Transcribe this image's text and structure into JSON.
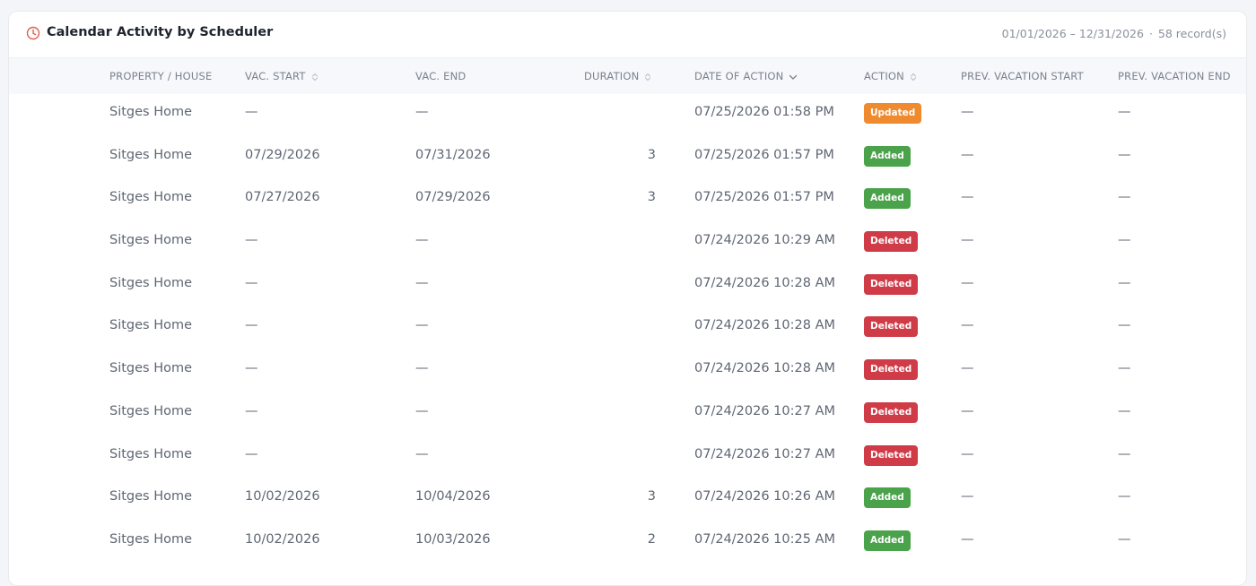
{
  "card": {
    "title": "Calendar Activity by Scheduler",
    "date_range": "01/01/2026 – 12/31/2026",
    "separator": "·",
    "record_count": "58 record(s)"
  },
  "columns": [
    {
      "label": "PROPERTY / HOUSE",
      "sortable": false,
      "sort": "none"
    },
    {
      "label": "VAC. START",
      "sortable": true,
      "sort": "none"
    },
    {
      "label": "VAC. END",
      "sortable": false,
      "sort": "none"
    },
    {
      "label": "DURATION",
      "sortable": true,
      "sort": "none"
    },
    {
      "label": "DATE OF ACTION",
      "sortable": true,
      "sort": "desc"
    },
    {
      "label": "ACTION",
      "sortable": true,
      "sort": "none"
    },
    {
      "label": "PREV. VACATION START",
      "sortable": false,
      "sort": "none"
    },
    {
      "label": "PREV. VACATION END",
      "sortable": false,
      "sort": "none"
    }
  ],
  "action_colors": {
    "Updated": "#ef8a2f",
    "Added": "#4aa24a",
    "Deleted": "#cf3b47"
  },
  "rows": [
    {
      "property": "Sitges Home",
      "vac_start": "—",
      "vac_end": "—",
      "duration": "",
      "date_of_action": "07/25/2026 01:58 PM",
      "action": "Updated",
      "prev_start": "—",
      "prev_end": "—"
    },
    {
      "property": "Sitges Home",
      "vac_start": "07/29/2026",
      "vac_end": "07/31/2026",
      "duration": "3",
      "date_of_action": "07/25/2026 01:57 PM",
      "action": "Added",
      "prev_start": "—",
      "prev_end": "—"
    },
    {
      "property": "Sitges Home",
      "vac_start": "07/27/2026",
      "vac_end": "07/29/2026",
      "duration": "3",
      "date_of_action": "07/25/2026 01:57 PM",
      "action": "Added",
      "prev_start": "—",
      "prev_end": "—"
    },
    {
      "property": "Sitges Home",
      "vac_start": "—",
      "vac_end": "—",
      "duration": "",
      "date_of_action": "07/24/2026 10:29 AM",
      "action": "Deleted",
      "prev_start": "—",
      "prev_end": "—"
    },
    {
      "property": "Sitges Home",
      "vac_start": "—",
      "vac_end": "—",
      "duration": "",
      "date_of_action": "07/24/2026 10:28 AM",
      "action": "Deleted",
      "prev_start": "—",
      "prev_end": "—"
    },
    {
      "property": "Sitges Home",
      "vac_start": "—",
      "vac_end": "—",
      "duration": "",
      "date_of_action": "07/24/2026 10:28 AM",
      "action": "Deleted",
      "prev_start": "—",
      "prev_end": "—"
    },
    {
      "property": "Sitges Home",
      "vac_start": "—",
      "vac_end": "—",
      "duration": "",
      "date_of_action": "07/24/2026 10:28 AM",
      "action": "Deleted",
      "prev_start": "—",
      "prev_end": "—"
    },
    {
      "property": "Sitges Home",
      "vac_start": "—",
      "vac_end": "—",
      "duration": "",
      "date_of_action": "07/24/2026 10:27 AM",
      "action": "Deleted",
      "prev_start": "—",
      "prev_end": "—"
    },
    {
      "property": "Sitges Home",
      "vac_start": "—",
      "vac_end": "—",
      "duration": "",
      "date_of_action": "07/24/2026 10:27 AM",
      "action": "Deleted",
      "prev_start": "—",
      "prev_end": "—"
    },
    {
      "property": "Sitges Home",
      "vac_start": "10/02/2026",
      "vac_end": "10/04/2026",
      "duration": "3",
      "date_of_action": "07/24/2026 10:26 AM",
      "action": "Added",
      "prev_start": "—",
      "prev_end": "—"
    },
    {
      "property": "Sitges Home",
      "vac_start": "10/02/2026",
      "vac_end": "10/03/2026",
      "duration": "2",
      "date_of_action": "07/24/2026 10:25 AM",
      "action": "Added",
      "prev_start": "—",
      "prev_end": "—"
    }
  ]
}
